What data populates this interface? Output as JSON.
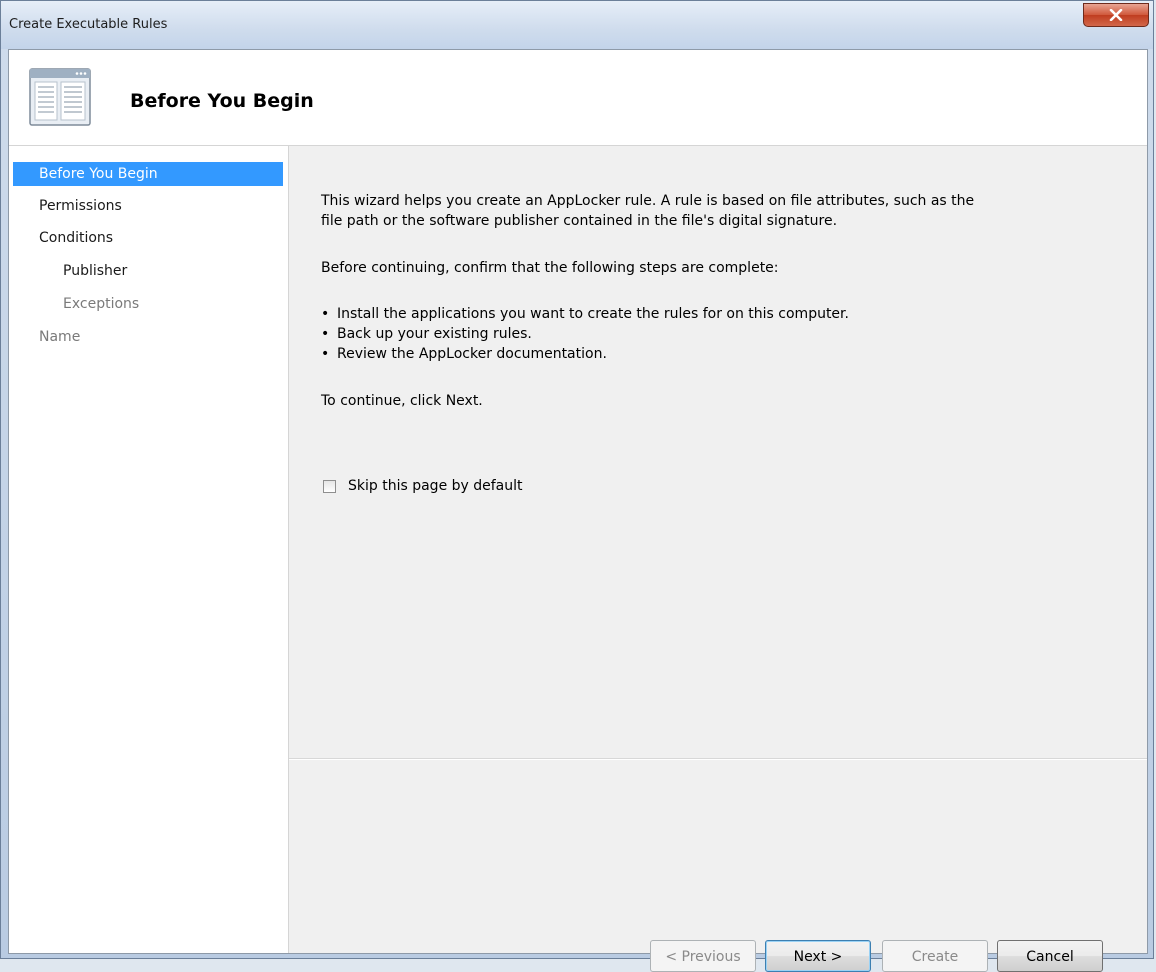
{
  "window": {
    "title": "Create Executable Rules"
  },
  "header": {
    "title": "Before You Begin"
  },
  "nav": {
    "items": [
      {
        "label": "Before You Begin",
        "state": "selected"
      },
      {
        "label": "Permissions",
        "state": "normal"
      },
      {
        "label": "Conditions",
        "state": "normal"
      },
      {
        "label": "Publisher",
        "state": "sub"
      },
      {
        "label": "Exceptions",
        "state": "sub-disabled"
      },
      {
        "label": "Name",
        "state": "disabled"
      }
    ]
  },
  "content": {
    "intro_line1": "This wizard helps you create an AppLocker rule. A rule is based on file attributes, such as the",
    "intro_line2": "file path or the software publisher contained in the file's digital signature.",
    "confirm": "Before continuing, confirm that the following steps are complete:",
    "bullets": [
      "Install the applications you want to create the rules for on this computer.",
      "Back up your existing rules.",
      "Review the AppLocker documentation."
    ],
    "bullet_char": "•",
    "continue": "To continue, click Next.",
    "skip_checkbox": {
      "label": "Skip this page by default",
      "checked": false
    }
  },
  "buttons": {
    "previous": "< Previous",
    "next": "Next >",
    "create": "Create",
    "cancel": "Cancel"
  },
  "colors": {
    "selection": "#3399ff",
    "close_button": "#c03d20"
  },
  "icons": {
    "close": "close-icon",
    "wizard": "wizard-window-icon"
  }
}
